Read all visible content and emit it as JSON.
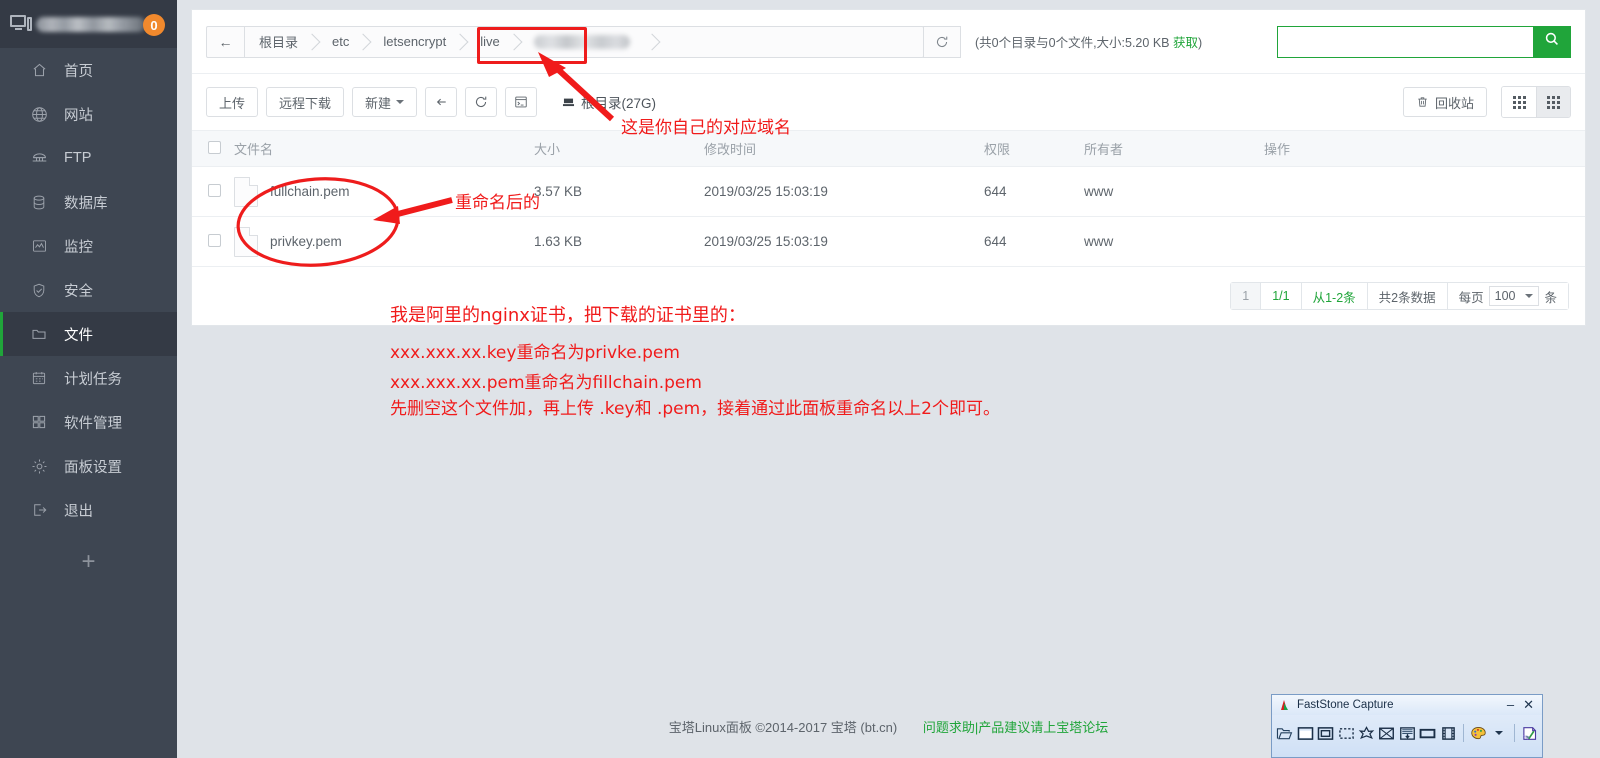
{
  "sidebar": {
    "header": {
      "site_name_masked": "",
      "badge_count": "0"
    },
    "items": [
      {
        "label": "首页",
        "icon": "home-icon",
        "active": false
      },
      {
        "label": "网站",
        "icon": "globe-icon",
        "active": false
      },
      {
        "label": "FTP",
        "icon": "ftp-icon",
        "active": false
      },
      {
        "label": "数据库",
        "icon": "database-icon",
        "active": false
      },
      {
        "label": "监控",
        "icon": "monitor-chart-icon",
        "active": false
      },
      {
        "label": "安全",
        "icon": "shield-icon",
        "active": false
      },
      {
        "label": "文件",
        "icon": "folder-icon",
        "active": true
      },
      {
        "label": "计划任务",
        "icon": "calendar-icon",
        "active": false
      },
      {
        "label": "软件管理",
        "icon": "grid-apps-icon",
        "active": false
      },
      {
        "label": "面板设置",
        "icon": "gear-icon",
        "active": false
      },
      {
        "label": "退出",
        "icon": "logout-icon",
        "active": false
      }
    ],
    "add_label": "+"
  },
  "breadcrumb": {
    "back_label": "←",
    "crumbs": [
      "根目录",
      "etc",
      "letsencrypt",
      "live"
    ],
    "masked_crumb": "",
    "refresh_label": "⟳",
    "stats": "(共0个目录与0个文件,大小:5.20 KB ",
    "stats_link": "获取",
    "stats_tail": ")"
  },
  "search": {
    "value": "",
    "placeholder": "",
    "icon": "search-icon"
  },
  "toolbar": {
    "upload_label": "上传",
    "remote_download_label": "远程下载",
    "new_label": "新建",
    "back_label": "←",
    "refresh_label": "⟳",
    "terminal_label": "",
    "disk_label": "根目录(27G)",
    "recycle_label": "回收站",
    "view_grid_label": "",
    "view_list_label": ""
  },
  "table": {
    "headers": [
      "文件名",
      "大小",
      "修改时间",
      "权限",
      "所有者",
      "操作"
    ],
    "rows": [
      {
        "name": "fullchain.pem",
        "size": "3.57 KB",
        "mtime": "2019/03/25 15:03:19",
        "perm": "644",
        "owner": "www",
        "op": ""
      },
      {
        "name": "privkey.pem",
        "size": "1.63 KB",
        "mtime": "2019/03/25 15:03:19",
        "perm": "644",
        "owner": "www",
        "op": ""
      }
    ]
  },
  "pagination": {
    "page_num": "1",
    "page_of": "1/1",
    "range": "从1-2条",
    "total": "共2条数据",
    "per_page_label": "每页",
    "per_page_value": "100",
    "unit": "条"
  },
  "footer": {
    "copyright": "宝塔Linux面板 ©2014-2017 宝塔 (bt.cn)",
    "link": "问题求助|产品建议请上宝塔论坛"
  },
  "annotations": {
    "domain_note": "这是你自己的对应域名",
    "rename_note": "重命名后的",
    "line1": "我是阿里的nginx证书，把下载的证书里的：",
    "line2": "xxx.xxx.xx.key重命名为privke.pem",
    "line3": "xxx.xxx.xx.pem重命名为fillchain.pem",
    "line4": "先删空这个文件加，再上传 .key和 .pem，接着通过此面板重命名以上2个即可。",
    "color": "#f01b1b"
  },
  "faststone": {
    "title": "FastStone Capture",
    "minimize": "–",
    "close": "✕",
    "tools": [
      "open-icon",
      "window-capture-icon",
      "object-capture-icon",
      "rect-capture-icon",
      "freehand-capture-icon",
      "fullscreen-capture-icon",
      "scrolling-capture-icon",
      "fixed-region-icon",
      "video-record-icon",
      "palette-icon",
      "editor-icon"
    ]
  },
  "colors": {
    "sidebar_bg": "#3e4652",
    "sidebar_head": "#343a45",
    "accent_green": "#20a53a",
    "badge_orange": "#f1892d",
    "annotation_red": "#f01b1b",
    "page_bg": "#dfe3e8"
  }
}
